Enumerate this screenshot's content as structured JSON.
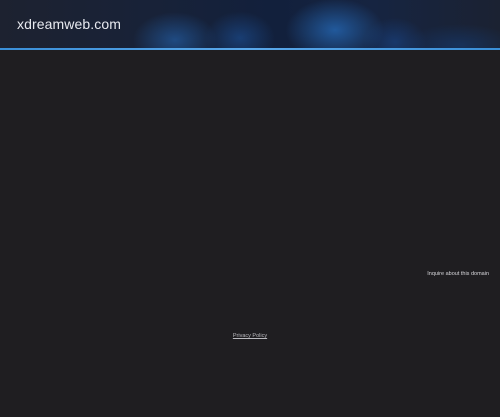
{
  "header": {
    "site_title": "xdreamweb.com"
  },
  "main": {
    "inquire_link": "Inquire about this domain"
  },
  "footer": {
    "privacy_policy": "Privacy Policy"
  },
  "colors": {
    "background": "#1f1e21",
    "header_accent": "#3a8fd8",
    "text": "#e8eaf0"
  }
}
